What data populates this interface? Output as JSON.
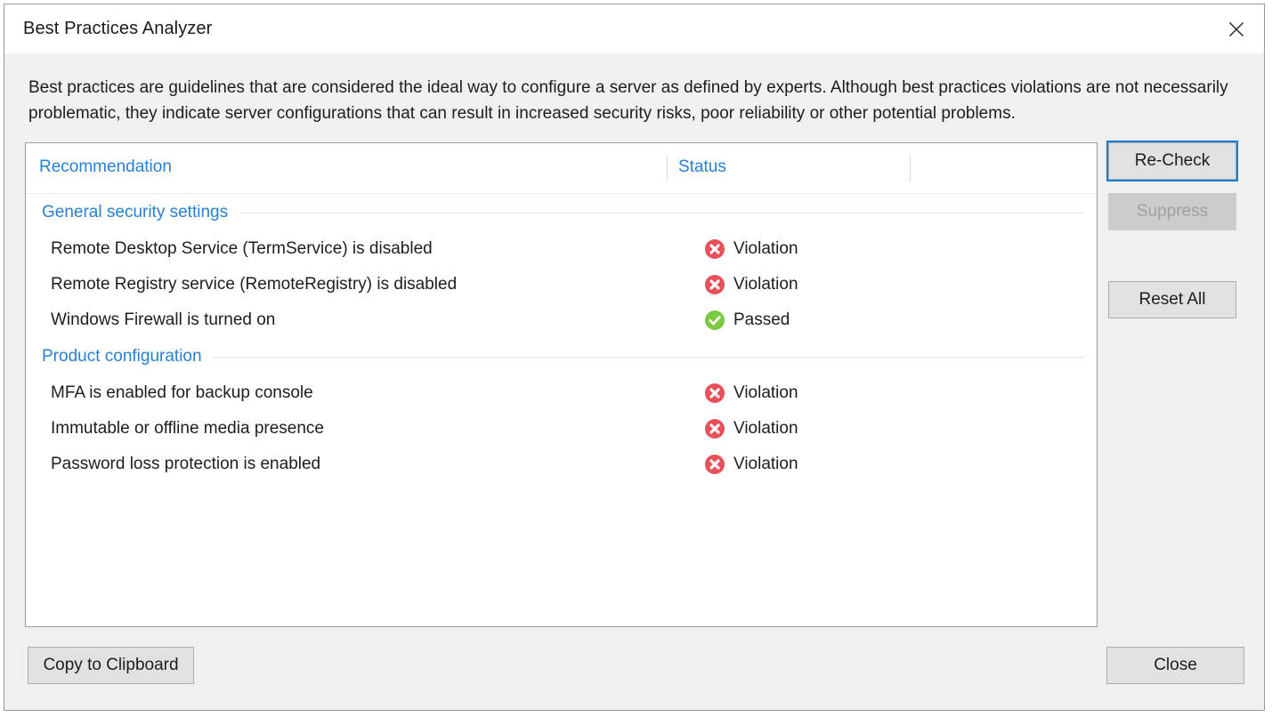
{
  "window": {
    "title": "Best Practices Analyzer",
    "close_icon": "close-icon"
  },
  "description": "Best practices are guidelines that are considered the ideal way to configure a server as defined by experts. Although best practices violations are not necessarily problematic, they indicate server configurations that can result in increased security risks, poor reliability or other potential problems.",
  "colors": {
    "accent_blue": "#2980d4",
    "violation_red": "#e8505b",
    "passed_green": "#7ac943",
    "focus_blue": "#0c7cd5",
    "dialog_bg": "#f0f0f0",
    "list_bg": "#ffffff"
  },
  "list": {
    "columns": [
      {
        "key": "recommendation",
        "label": "Recommendation"
      },
      {
        "key": "status",
        "label": "Status"
      },
      {
        "key": "extra",
        "label": ""
      }
    ],
    "groups": [
      {
        "name": "General security settings",
        "rows": [
          {
            "recommendation": "Remote Desktop Service (TermService) is disabled",
            "status": "Violation",
            "icon": "violation-icon"
          },
          {
            "recommendation": "Remote Registry service (RemoteRegistry) is disabled",
            "status": "Violation",
            "icon": "violation-icon"
          },
          {
            "recommendation": "Windows Firewall is turned on",
            "status": "Passed",
            "icon": "passed-icon"
          }
        ]
      },
      {
        "name": "Product configuration",
        "rows": [
          {
            "recommendation": "MFA is enabled for backup console",
            "status": "Violation",
            "icon": "violation-icon"
          },
          {
            "recommendation": "Immutable or offline media presence",
            "status": "Violation",
            "icon": "violation-icon"
          },
          {
            "recommendation": "Password loss protection is enabled",
            "status": "Violation",
            "icon": "violation-icon"
          }
        ]
      }
    ]
  },
  "side_buttons": {
    "recheck": "Re-Check",
    "suppress": "Suppress",
    "reset_all": "Reset All"
  },
  "footer": {
    "copy_to_clipboard": "Copy to Clipboard",
    "close": "Close"
  }
}
